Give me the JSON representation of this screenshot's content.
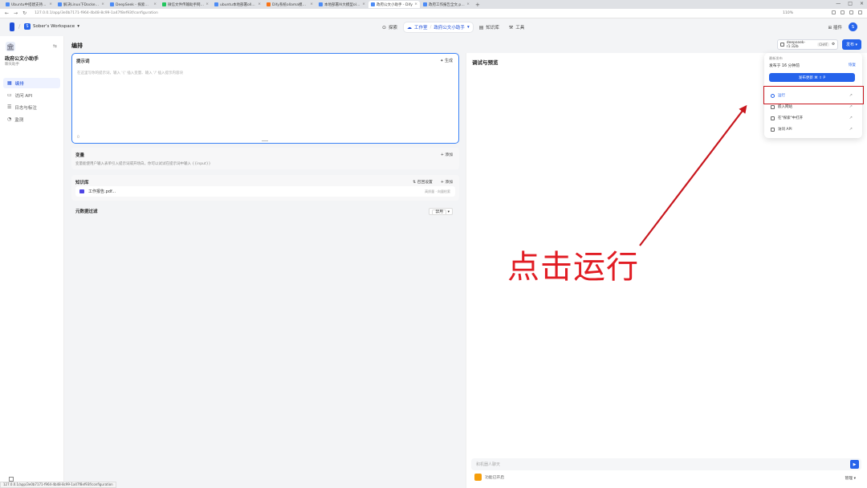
{
  "browser": {
    "tabs": [
      {
        "label": "Ubuntu中搭建支持Docker",
        "active": false
      },
      {
        "label": "解决Linux下Docker Issue",
        "active": false
      },
      {
        "label": "DeepSeek - 探索未至之境",
        "active": false
      },
      {
        "label": "微信文件传输助手网页版",
        "active": false
      },
      {
        "label": "ubuntu本地部署ollama",
        "active": false
      },
      {
        "label": "Dify系统ollama模型下载",
        "active": false
      },
      {
        "label": "本地部署AI大模型ollama",
        "active": false
      },
      {
        "label": "政府公文小助手 - Dify",
        "active": true
      },
      {
        "label": "政府工作报告全文.pdf_百",
        "active": false
      }
    ],
    "url": "127.0.0.1/app/3e0b7171-f964-4b48-8c99-1a47f8ef93f/configuration",
    "zoom": "110%"
  },
  "header": {
    "workspace_initial": "S",
    "workspace": "Sober's Workspace",
    "nav": {
      "explore": "探索",
      "studio": "工作室",
      "current_app": "政府公文小助手",
      "knowledge": "知识库",
      "tools": "工具"
    },
    "plugins": "插件",
    "avatar": "S"
  },
  "sidebar": {
    "app_name": "政府公文小助手",
    "app_type": "聊天助手",
    "items": [
      {
        "label": "编排",
        "icon": "edit-icon",
        "active": true
      },
      {
        "label": "访问 API",
        "icon": "api-icon",
        "active": false
      },
      {
        "label": "日志与标注",
        "icon": "log-icon",
        "active": false
      },
      {
        "label": "监测",
        "icon": "monitor-icon",
        "active": false
      }
    ]
  },
  "editor": {
    "title": "编排",
    "prompt": {
      "title": "提示词",
      "generate": "生成",
      "placeholder": "在这里写你的提示词，输入 '{' 插入变量、输入 '/' 插入提示内容块",
      "count": "0"
    },
    "variables": {
      "title": "变量",
      "add": "添加",
      "description": "变量能使用户输入表单引入提示词或开场白，你可以试试在提示词中输入 {{input}}"
    },
    "knowledge": {
      "title": "知识库",
      "recall": "召回设置",
      "add": "添加",
      "file_name": "工作报告.pdf...",
      "file_meta": "高质量 · 向量检索"
    },
    "metadata": {
      "title": "元数据过滤",
      "mode": "禁用"
    }
  },
  "debug": {
    "title": "调试与预览",
    "input_placeholder": "和机器人聊天",
    "features": "功能已开启",
    "manage": "管理"
  },
  "model": {
    "name": "deepseek-r1:32b",
    "mode": "CHAT"
  },
  "publish": {
    "button": "发布",
    "version_label": "最新发布",
    "published_info": "发布于 16 分钟前",
    "restore": "恢复",
    "update": "发布更新 ⌘ ⇧ P",
    "items": [
      {
        "label": "运行",
        "highlight": true
      },
      {
        "label": "嵌入网站",
        "highlight": false
      },
      {
        "label": "在\"探索\"中打开",
        "highlight": false
      },
      {
        "label": "访问 API",
        "highlight": false
      }
    ]
  },
  "annotation": {
    "text": "点击运行",
    "color": "#e11d24"
  },
  "status_url": "127.0.0.1/app/3e0b7171-f964-4b48-8c99-1a47f8ef93f/configuration"
}
